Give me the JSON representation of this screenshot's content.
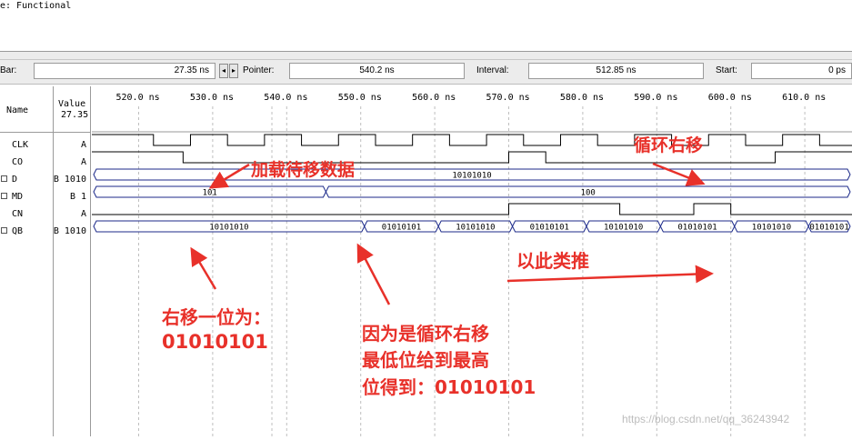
{
  "mode_text": "e: Functional",
  "toolbar": {
    "bar_label": "Bar:",
    "bar_value": "27.35 ns",
    "pointer_label": "Pointer:",
    "pointer_value": "540.2 ns",
    "interval_label": "Interval:",
    "interval_value": "512.85 ns",
    "start_label": "Start:",
    "start_value": "0 ps",
    "nav_left": "◂",
    "nav_right": "▸"
  },
  "columns": {
    "name": "Name",
    "value": "Value",
    "value_time": "27.35"
  },
  "timeline": [
    "520.0 ns",
    "530.0 ns",
    "540.0 ns",
    "550.0 ns",
    "560.0 ns",
    "570.0 ns",
    "580.0 ns",
    "590.0 ns",
    "600.0 ns",
    "610.0 ns"
  ],
  "signals": [
    {
      "name": "CLK",
      "value": "A",
      "icon": false
    },
    {
      "name": "CO",
      "value": "A",
      "icon": false
    },
    {
      "name": "D",
      "value": "B 1010",
      "icon": true
    },
    {
      "name": "MD",
      "value": "B 1",
      "icon": true
    },
    {
      "name": "CN",
      "value": "A",
      "icon": false
    },
    {
      "name": "QB",
      "value": "B 1010",
      "icon": true
    }
  ],
  "bus_labels": {
    "D": [
      "10101010"
    ],
    "MD": [
      "101",
      "100"
    ],
    "QB": [
      "10101010",
      "01010101",
      "10101010",
      "01010101",
      "10101010",
      "01010101",
      "10101010",
      "01010101"
    ]
  },
  "annotations": {
    "load": "加载待移数据",
    "cycle": "循环右移",
    "shift_line1": "右移一位为：",
    "shift_line2": "01010101",
    "reason_line1": "因为是循环右移",
    "reason_line2": "最低位给到最高",
    "reason_line3": "位得到：01010101",
    "and_so_on": "以此类推"
  },
  "watermark": "https://blog.csdn.net/qq_36243942",
  "colors": {
    "annotation": "#e8312a",
    "waveform": "#000000",
    "bus": "#1c2a8a",
    "grid": "#bfbfbf"
  }
}
